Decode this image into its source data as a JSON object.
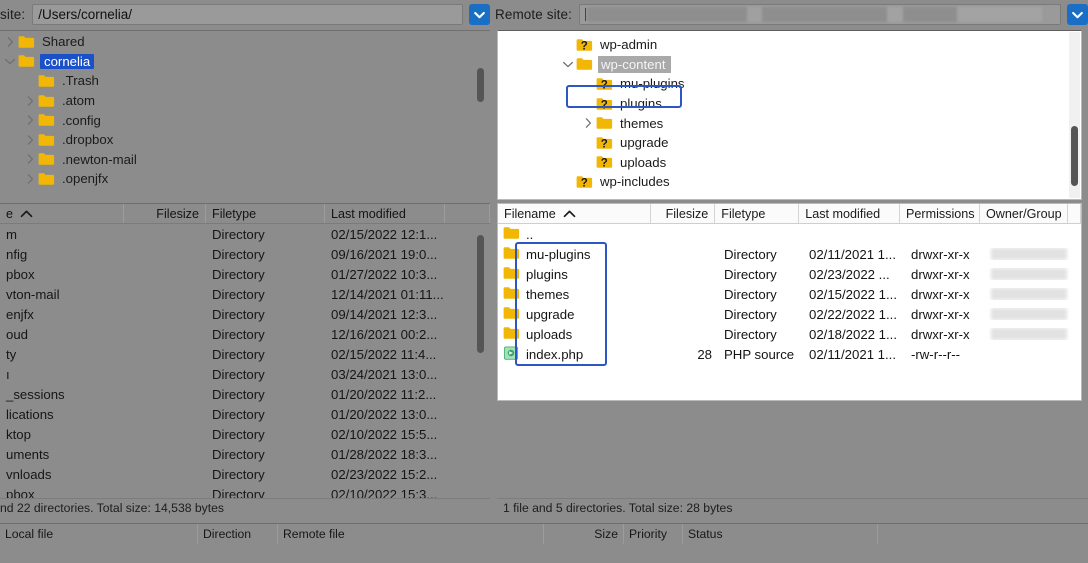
{
  "app": {
    "kind": "ftp-client"
  },
  "local": {
    "path_label": "site:",
    "path_value": "/Users/cornelia/",
    "tree": [
      {
        "name": "Shared",
        "indent": 1,
        "twisty": "right",
        "icon": "folder"
      },
      {
        "name": "cornelia",
        "indent": 1,
        "twisty": "down",
        "icon": "folder",
        "selected": true
      },
      {
        "name": ".Trash",
        "indent": 2,
        "twisty": "none",
        "icon": "folder"
      },
      {
        "name": ".atom",
        "indent": 2,
        "twisty": "right",
        "icon": "folder"
      },
      {
        "name": ".config",
        "indent": 2,
        "twisty": "right",
        "icon": "folder"
      },
      {
        "name": ".dropbox",
        "indent": 2,
        "twisty": "right",
        "icon": "folder"
      },
      {
        "name": ".newton-mail",
        "indent": 2,
        "twisty": "right",
        "icon": "folder"
      },
      {
        "name": ".openjfx",
        "indent": 2,
        "twisty": "right",
        "icon": "folder"
      }
    ],
    "columns": [
      "e",
      "Filesize",
      "Filetype",
      "Last modified"
    ],
    "sort_column": "e",
    "sort_dir": "asc",
    "rows": [
      {
        "name": "m",
        "filesize": "",
        "filetype": "Directory",
        "modified": "02/15/2022 12:1..."
      },
      {
        "name": "nfig",
        "filesize": "",
        "filetype": "Directory",
        "modified": "09/16/2021 19:0..."
      },
      {
        "name": "pbox",
        "filesize": "",
        "filetype": "Directory",
        "modified": "01/27/2022 10:3..."
      },
      {
        "name": "vton-mail",
        "filesize": "",
        "filetype": "Directory",
        "modified": "12/14/2021 01:11..."
      },
      {
        "name": "enjfx",
        "filesize": "",
        "filetype": "Directory",
        "modified": "09/14/2021 12:3..."
      },
      {
        "name": "oud",
        "filesize": "",
        "filetype": "Directory",
        "modified": "12/16/2021 00:2..."
      },
      {
        "name": "ty",
        "filesize": "",
        "filetype": "Directory",
        "modified": "02/15/2022 11:4..."
      },
      {
        "name": "ı",
        "filesize": "",
        "filetype": "Directory",
        "modified": "03/24/2021 13:0..."
      },
      {
        "name": "_sessions",
        "filesize": "",
        "filetype": "Directory",
        "modified": "01/20/2022 11:2..."
      },
      {
        "name": "lications",
        "filesize": "",
        "filetype": "Directory",
        "modified": "01/20/2022 13:0..."
      },
      {
        "name": "ktop",
        "filesize": "",
        "filetype": "Directory",
        "modified": "02/10/2022 15:5..."
      },
      {
        "name": "uments",
        "filesize": "",
        "filetype": "Directory",
        "modified": "01/28/2022 18:3..."
      },
      {
        "name": "vnloads",
        "filesize": "",
        "filetype": "Directory",
        "modified": "02/23/2022 15:2..."
      },
      {
        "name": "pbox",
        "filesize": "",
        "filetype": "Directory",
        "modified": "02/10/2022 15:3..."
      }
    ],
    "status": "nd 22 directories. Total size: 14,538 bytes"
  },
  "remote": {
    "path_label": "Remote site:",
    "path_value": "",
    "tree": [
      {
        "name": "wp-admin",
        "indent": 2,
        "twisty": "none",
        "icon": "folder-unknown"
      },
      {
        "name": "wp-content",
        "indent": 2,
        "twisty": "down",
        "icon": "folder",
        "highlighted": true
      },
      {
        "name": "mu-plugins",
        "indent": 3,
        "twisty": "none",
        "icon": "folder-unknown"
      },
      {
        "name": "plugins",
        "indent": 3,
        "twisty": "none",
        "icon": "folder-unknown"
      },
      {
        "name": "themes",
        "indent": 3,
        "twisty": "right",
        "icon": "folder"
      },
      {
        "name": "upgrade",
        "indent": 3,
        "twisty": "none",
        "icon": "folder-unknown"
      },
      {
        "name": "uploads",
        "indent": 3,
        "twisty": "none",
        "icon": "folder-unknown"
      },
      {
        "name": "wp-includes",
        "indent": 2,
        "twisty": "none",
        "icon": "folder-unknown"
      }
    ],
    "columns": [
      "Filename",
      "Filesize",
      "Filetype",
      "Last modified",
      "Permissions",
      "Owner/Group"
    ],
    "sort_column": "Filename",
    "sort_dir": "asc",
    "rows": [
      {
        "name": "..",
        "filesize": "",
        "filetype": "",
        "modified": "",
        "permissions": "",
        "owner": "",
        "icon": "folder"
      },
      {
        "name": "mu-plugins",
        "filesize": "",
        "filetype": "Directory",
        "modified": "02/11/2021 1...",
        "permissions": "drwxr-xr-x",
        "owner": "REDACTED",
        "icon": "folder"
      },
      {
        "name": "plugins",
        "filesize": "",
        "filetype": "Directory",
        "modified": "02/23/2022 ...",
        "permissions": "drwxr-xr-x",
        "owner": "REDACTED",
        "icon": "folder"
      },
      {
        "name": "themes",
        "filesize": "",
        "filetype": "Directory",
        "modified": "02/15/2022 1...",
        "permissions": "drwxr-xr-x",
        "owner": "REDACTED",
        "icon": "folder"
      },
      {
        "name": "upgrade",
        "filesize": "",
        "filetype": "Directory",
        "modified": "02/22/2022 1...",
        "permissions": "drwxr-xr-x",
        "owner": "REDACTED",
        "icon": "folder"
      },
      {
        "name": "uploads",
        "filesize": "",
        "filetype": "Directory",
        "modified": "02/18/2022 1...",
        "permissions": "drwxr-xr-x",
        "owner": "REDACTED",
        "icon": "folder"
      },
      {
        "name": "index.php",
        "filesize": "28",
        "filetype": "PHP source",
        "modified": "02/11/2021 1...",
        "permissions": "-rw-r--r--",
        "owner": "",
        "icon": "php-file"
      }
    ],
    "status": "1 file and 5 directories. Total size: 28 bytes"
  },
  "queue": {
    "columns": [
      "Local file",
      "Direction",
      "Remote file",
      "Size",
      "Priority",
      "Status"
    ]
  },
  "colors": {
    "chrome": "#8c8c8c",
    "folder": "#f2b705",
    "selection_blue": "#1a50c8",
    "highlight_box": "#2d56c4",
    "dropdown_blue": "#1a6fc4",
    "pane_white": "#ffffff"
  }
}
